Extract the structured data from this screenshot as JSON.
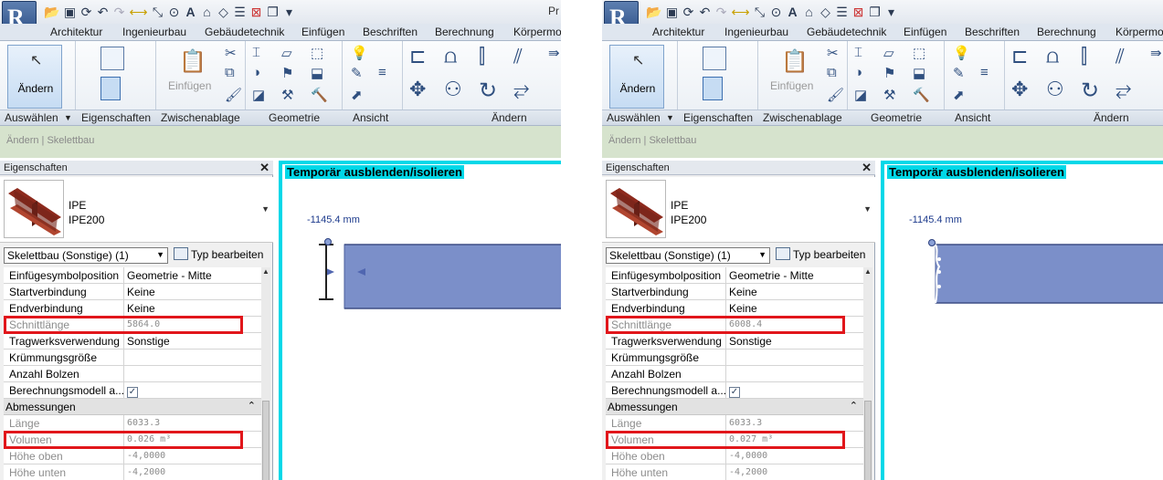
{
  "app": {
    "logo_letter": "R",
    "title_fragment": "Pr"
  },
  "qat_icons": [
    "open-icon",
    "save-icon",
    "sync-icon",
    "undo-icon",
    "redo-icon",
    "measure-icon",
    "dimension-icon",
    "tag-icon",
    "text-icon",
    "3d-view-icon",
    "section-icon",
    "thin-lines-icon",
    "close-views-icon",
    "switch-windows-icon",
    "customize-icon"
  ],
  "tabs": [
    "Architektur",
    "Ingenieurbau",
    "Gebäudetechnik",
    "Einfügen",
    "Beschriften",
    "Berechnung",
    "Körpermo"
  ],
  "ribbon": {
    "modify_label": "Ändern",
    "paste_label": "Einfügen",
    "groups": {
      "select": "Auswählen",
      "properties": "Eigenschaften",
      "clipboard": "Zwischenablage",
      "geometry": "Geometrie",
      "view": "Ansicht",
      "modify": "Ändern"
    }
  },
  "options_bar": {
    "text": "Ändern | Skelettbau"
  },
  "properties": {
    "title": "Eigenschaften",
    "close_symbol": "✕",
    "type_family": "IPE",
    "type_name": "IPE200",
    "filter": "Skelettbau (Sonstige) (1)",
    "edit_type": "Typ bearbeiten",
    "section_dimensions": "Abmessungen",
    "labels": {
      "insertion": "Einfügesymbolposition",
      "start_conn": "Startverbindung",
      "end_conn": "Endverbindung",
      "cut_length": "Schnittlänge",
      "structural_usage": "Tragwerksverwendung",
      "camber": "Krümmungsgröße",
      "studs": "Anzahl Bolzen",
      "analytical": "Berechnungsmodell a...",
      "length": "Länge",
      "volume": "Volumen",
      "height_top": "Höhe oben",
      "height_bottom": "Höhe unten"
    }
  },
  "view": {
    "title": "Temporär ausblenden/isolieren",
    "dimension": "-1145.4 mm"
  },
  "left": {
    "values": {
      "insertion": "Geometrie - Mitte",
      "start_conn": "Keine",
      "end_conn": "Keine",
      "cut_length": "5864.0",
      "structural_usage": "Sonstige",
      "camber": "",
      "studs": "",
      "analytical": "✓",
      "length": "6033.3",
      "volume": "0.026 m³",
      "height_top": "-4,0000",
      "height_bottom": "-4,2000"
    }
  },
  "right": {
    "values": {
      "insertion": "Geometrie - Mitte",
      "start_conn": "Keine",
      "end_conn": "Keine",
      "cut_length": "6008.4",
      "structural_usage": "Sonstige",
      "camber": "",
      "studs": "",
      "analytical": "✓",
      "length": "6033.3",
      "volume": "0.027 m³",
      "height_top": "-4,0000",
      "height_bottom": "-4,2000"
    }
  },
  "colors": {
    "highlight": "#e1161b",
    "view_border": "#00d8e8",
    "beam_fill": "#7b8fc9",
    "status_bar": "#d6e3cd"
  }
}
